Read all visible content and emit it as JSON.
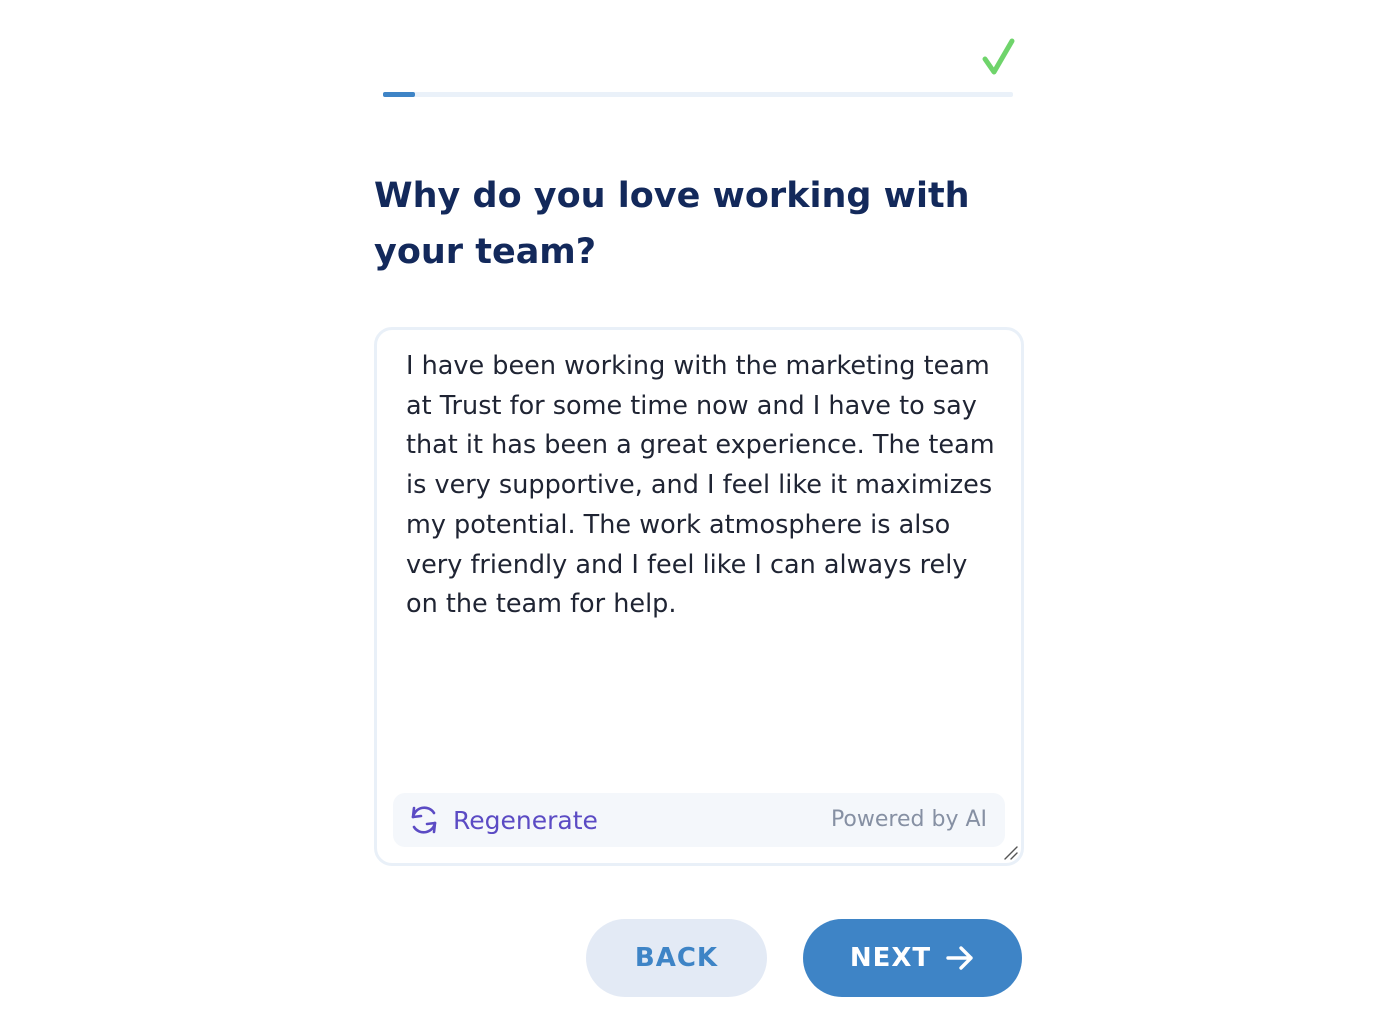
{
  "progress": {
    "fraction": 0.05,
    "complete_icon": "checkmark-icon",
    "complete_color": "#6fd46b",
    "fill_color": "#3e84c6"
  },
  "question": "Why do you love working with your team?",
  "answer": {
    "text": "I have been working with the marketing team at Trust for some time now and I have to say that it has been a great experience. The team is very supportive, and I feel like it maximizes my potential. The work atmosphere is also very friendly and I feel like I can always rely on the team for help."
  },
  "ai_bar": {
    "regenerate_label": "Regenerate",
    "regenerate_icon": "refresh-icon",
    "powered_by": "Powered by AI"
  },
  "nav": {
    "back_label": "BACK",
    "next_label": "NEXT",
    "next_icon": "arrow-right-icon"
  },
  "colors": {
    "heading": "#13295b",
    "accent": "#3e84c6",
    "regenerate": "#5b4bc4"
  }
}
